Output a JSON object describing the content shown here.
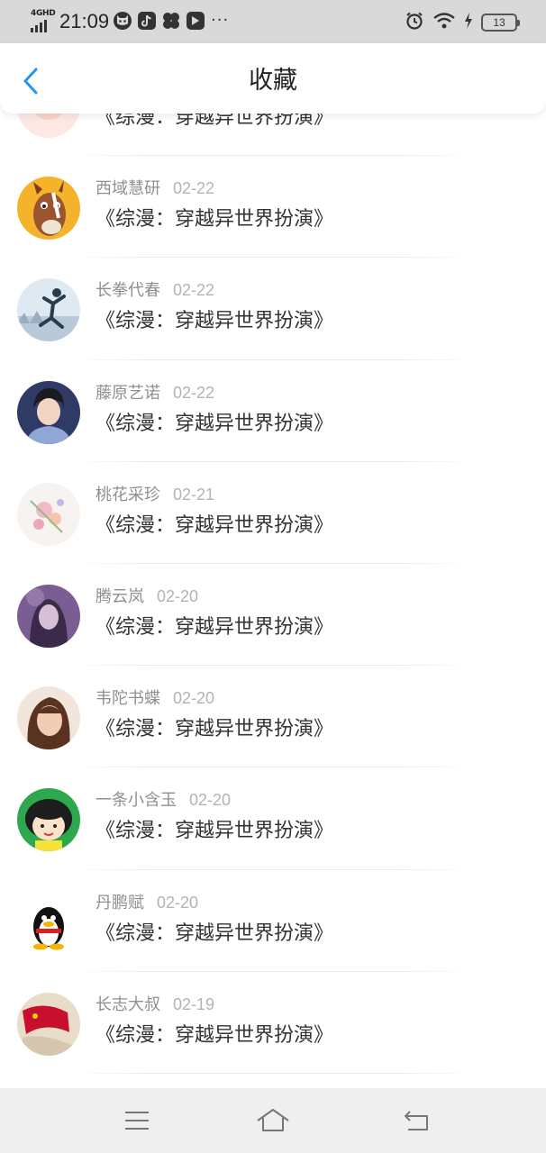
{
  "status_bar": {
    "network": "4GHD",
    "time": "21:09",
    "app_icons": [
      "cat-face-icon",
      "douyin-icon",
      "pinwheel-icon",
      "video-play-icon"
    ],
    "more": "···",
    "battery": "13"
  },
  "header": {
    "title": "收藏"
  },
  "favorites": [
    {
      "user": "",
      "date": "",
      "book": "《综漫：穿越异世界扮演》",
      "avatar": "peach-figure"
    },
    {
      "user": "西域慧研",
      "date": "02-22",
      "book": "《综漫：穿越异世界扮演》",
      "avatar": "cartoon-horse"
    },
    {
      "user": "长拳代春",
      "date": "02-22",
      "book": "《综漫：穿越异世界扮演》",
      "avatar": "jumping-silhouette"
    },
    {
      "user": "藤原艺诺",
      "date": "02-22",
      "book": "《综漫：穿越异世界扮演》",
      "avatar": "young-man-portrait"
    },
    {
      "user": "桃花采珍",
      "date": "02-21",
      "book": "《综漫：穿越异世界扮演》",
      "avatar": "flower-painting"
    },
    {
      "user": "腾云岚",
      "date": "02-20",
      "book": "《综漫：穿越异世界扮演》",
      "avatar": "purple-girl-portrait"
    },
    {
      "user": "韦陀书蝶",
      "date": "02-20",
      "book": "《综漫：穿越异世界扮演》",
      "avatar": "woman-portrait"
    },
    {
      "user": "一条小含玉",
      "date": "02-20",
      "book": "《综漫：穿越异世界扮演》",
      "avatar": "cartoon-girl"
    },
    {
      "user": "丹鹏赋",
      "date": "02-20",
      "book": "《综漫：穿越异世界扮演》",
      "avatar": "qq-penguin"
    },
    {
      "user": "长志大叔",
      "date": "02-19",
      "book": "《综漫：穿越异世界扮演》",
      "avatar": "flag-photo"
    }
  ],
  "nav_bar": {
    "icons": [
      "menu-icon",
      "home-icon",
      "back-nav-icon"
    ]
  },
  "colors": {
    "accent": "#2196F3",
    "status_bar_bg": "#D9D9D9",
    "nav_bar_bg": "#EFEFEF",
    "meta_text": "#8F8F8F"
  }
}
